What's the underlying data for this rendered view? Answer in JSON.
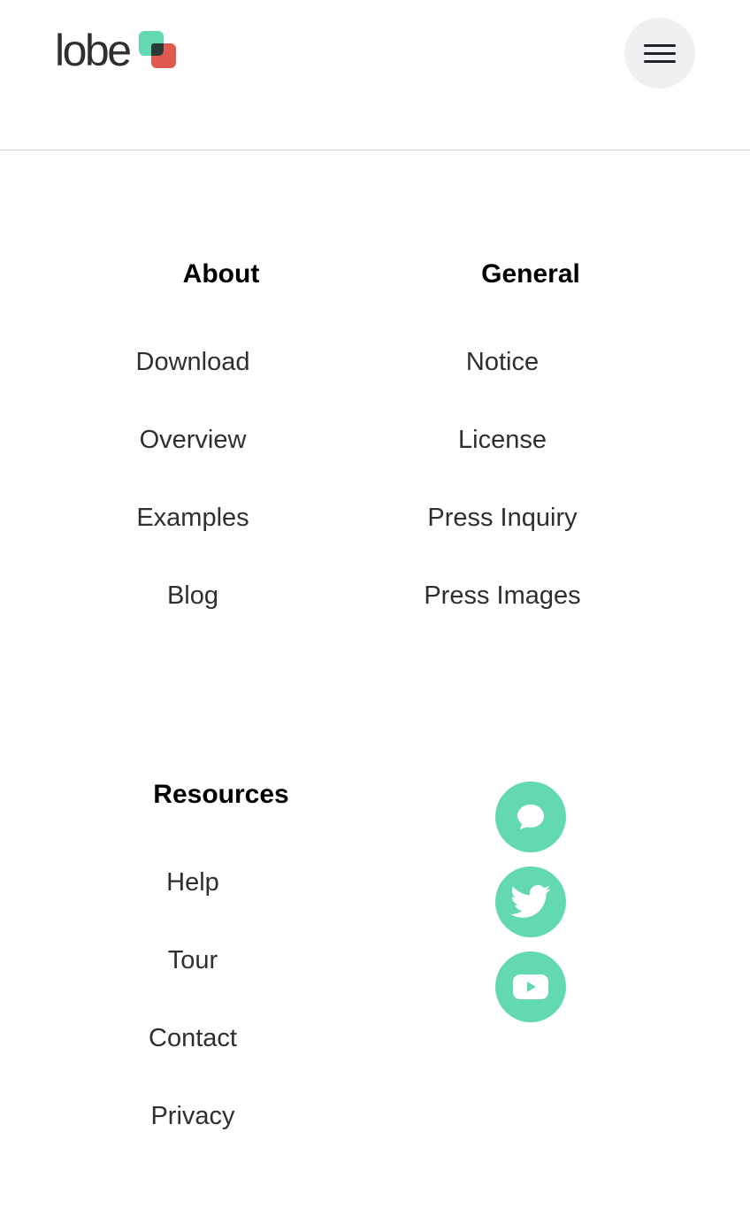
{
  "header": {
    "logo_text": "lobe",
    "menu_icon": "hamburger-menu-icon"
  },
  "footer": {
    "about": {
      "heading": "About",
      "links": [
        "Download",
        "Overview",
        "Examples",
        "Blog"
      ]
    },
    "general": {
      "heading": "General",
      "links": [
        "Notice",
        "License",
        "Press Inquiry",
        "Press Images"
      ]
    },
    "resources": {
      "heading": "Resources",
      "links": [
        "Help",
        "Tour",
        "Contact",
        "Privacy"
      ]
    },
    "social": [
      {
        "icon": "chat-bubble-icon"
      },
      {
        "icon": "twitter-bird-icon"
      },
      {
        "icon": "youtube-play-icon"
      }
    ]
  },
  "colors": {
    "accent_green": "#63d9b2",
    "accent_red": "#e05a50",
    "menu_button_bg": "#eef0f2",
    "divider": "#cfcfcf"
  }
}
